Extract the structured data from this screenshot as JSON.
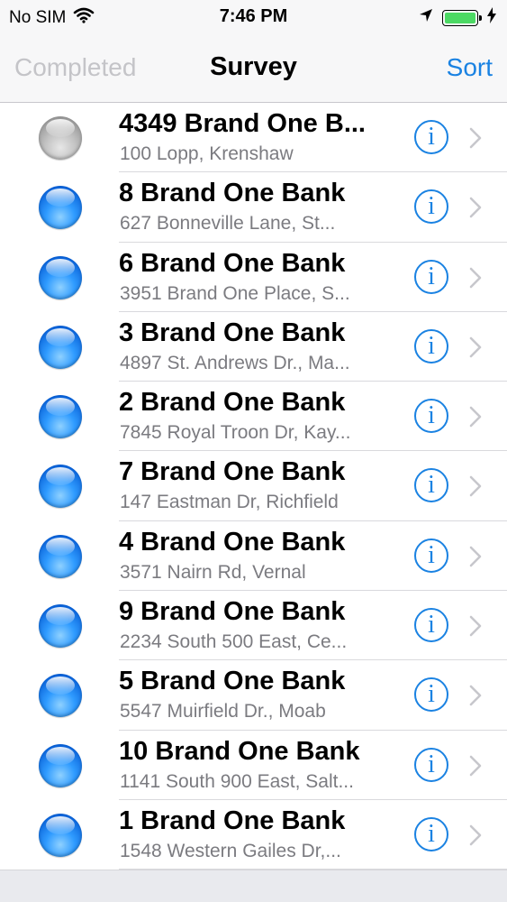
{
  "status_bar": {
    "carrier": "No SIM",
    "time": "7:46 PM"
  },
  "nav": {
    "left_label": "Completed",
    "title": "Survey",
    "right_label": "Sort"
  },
  "colors": {
    "accent": "#1a82e2",
    "battery": "#4cd964",
    "dot_blue": "#2f9bff",
    "dot_gray": "#bdbdbd"
  },
  "list": {
    "items": [
      {
        "title": "4349 Brand One B...",
        "subtitle": "100 Lopp, Krenshaw",
        "status": "gray"
      },
      {
        "title": "8 Brand One Bank",
        "subtitle": "627 Bonneville Lane, St...",
        "status": "blue"
      },
      {
        "title": "6 Brand One Bank",
        "subtitle": "3951 Brand One Place, S...",
        "status": "blue"
      },
      {
        "title": "3 Brand One Bank",
        "subtitle": "4897 St. Andrews Dr., Ma...",
        "status": "blue"
      },
      {
        "title": "2 Brand One Bank",
        "subtitle": "7845 Royal Troon Dr, Kay...",
        "status": "blue"
      },
      {
        "title": "7 Brand One Bank",
        "subtitle": "147 Eastman Dr, Richfield",
        "status": "blue"
      },
      {
        "title": "4 Brand One Bank",
        "subtitle": "3571 Nairn Rd, Vernal",
        "status": "blue"
      },
      {
        "title": "9 Brand One Bank",
        "subtitle": "2234 South 500 East, Ce...",
        "status": "blue"
      },
      {
        "title": "5 Brand One Bank",
        "subtitle": "5547 Muirfield Dr., Moab",
        "status": "blue"
      },
      {
        "title": "10 Brand One Bank",
        "subtitle": "1141 South 900 East, Salt...",
        "status": "blue"
      },
      {
        "title": "1 Brand One Bank",
        "subtitle": "1548 Western Gailes Dr,...",
        "status": "blue"
      }
    ],
    "info_glyph": "i"
  }
}
